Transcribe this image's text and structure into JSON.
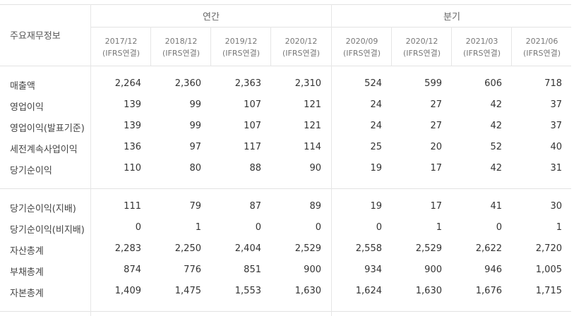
{
  "table": {
    "row_header_title": "주요재무정보",
    "groups": [
      {
        "label": "연간"
      },
      {
        "label": "분기"
      }
    ],
    "columns": [
      {
        "period": "2017/12",
        "basis": "(IFRS연결)"
      },
      {
        "period": "2018/12",
        "basis": "(IFRS연결)"
      },
      {
        "period": "2019/12",
        "basis": "(IFRS연결)"
      },
      {
        "period": "2020/12",
        "basis": "(IFRS연결)"
      },
      {
        "period": "2020/09",
        "basis": "(IFRS연결)"
      },
      {
        "period": "2020/12",
        "basis": "(IFRS연결)"
      },
      {
        "period": "2021/03",
        "basis": "(IFRS연결)"
      },
      {
        "period": "2021/06",
        "basis": "(IFRS연결)"
      }
    ],
    "rows": [
      {
        "label": "매출액",
        "values": [
          "2,264",
          "2,360",
          "2,363",
          "2,310",
          "524",
          "599",
          "606",
          "718"
        ]
      },
      {
        "label": "영업이익",
        "values": [
          "139",
          "99",
          "107",
          "121",
          "24",
          "27",
          "42",
          "37"
        ]
      },
      {
        "label": "영업이익(발표기준)",
        "values": [
          "139",
          "99",
          "107",
          "121",
          "24",
          "27",
          "42",
          "37"
        ]
      },
      {
        "label": "세전계속사업이익",
        "values": [
          "136",
          "97",
          "117",
          "114",
          "25",
          "20",
          "52",
          "40"
        ]
      },
      {
        "label": "당기순이익",
        "values": [
          "110",
          "80",
          "88",
          "90",
          "19",
          "17",
          "42",
          "31"
        ]
      },
      {
        "label": "당기순이익(지배)",
        "values": [
          "111",
          "79",
          "87",
          "89",
          "19",
          "17",
          "41",
          "30"
        ]
      },
      {
        "label": "당기순이익(비지배)",
        "values": [
          "0",
          "1",
          "0",
          "0",
          "0",
          "1",
          "0",
          "1"
        ]
      },
      {
        "label": "자산총계",
        "values": [
          "2,283",
          "2,250",
          "2,404",
          "2,529",
          "2,558",
          "2,529",
          "2,622",
          "2,720"
        ]
      },
      {
        "label": "부채총계",
        "values": [
          "874",
          "776",
          "851",
          "900",
          "934",
          "900",
          "946",
          "1,005"
        ]
      },
      {
        "label": "자본총계",
        "values": [
          "1,409",
          "1,475",
          "1,553",
          "1,630",
          "1,624",
          "1,630",
          "1,676",
          "1,715"
        ]
      }
    ]
  }
}
